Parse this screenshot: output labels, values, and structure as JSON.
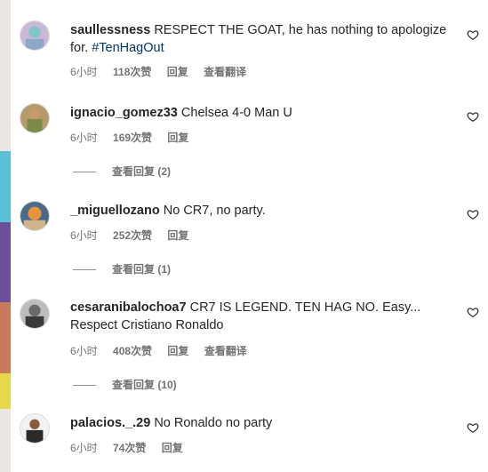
{
  "comments": [
    {
      "username": "saullessness",
      "text": "RESPECT THE GOAT, he has nothing to apologize for.",
      "hashtag": "#TenHagOut",
      "time": "6小时",
      "likes": "118次赞",
      "reply_label": "回复",
      "translate_label": "查看翻译",
      "avatar_colors": [
        "#c9b8d6",
        "#7fc7c9"
      ]
    },
    {
      "username": "ignacio_gomez33",
      "text": "Chelsea 4-0 Man U",
      "time": "6小时",
      "likes": "169次赞",
      "reply_label": "回复",
      "view_replies": "查看回复 (2)",
      "avatar_colors": [
        "#c99a6a",
        "#7a8a4a"
      ]
    },
    {
      "username": "_miguellozano",
      "text": "No CR7, no party.",
      "time": "6小时",
      "likes": "252次赞",
      "reply_label": "回复",
      "view_replies": "查看回复 (1)",
      "avatar_colors": [
        "#e8923a",
        "#4a6a8a"
      ]
    },
    {
      "username": "cesaranibalochoa7",
      "text": "CR7 IS LEGEND. TEN HAG NO. Easy... Respect Cristiano Ronaldo",
      "time": "6小时",
      "likes": "408次赞",
      "reply_label": "回复",
      "translate_label": "查看翻译",
      "view_replies": "查看回复 (10)",
      "avatar_colors": [
        "#9a9a9a",
        "#3a3a3a"
      ]
    },
    {
      "username": "palacios._.29",
      "text": "No Ronaldo no party",
      "time": "6小时",
      "likes": "74次赞",
      "reply_label": "回复",
      "avatar_colors": [
        "#e0e0e0",
        "#2a2a2a"
      ]
    }
  ],
  "colors": {
    "text": "#262626",
    "secondary": "#737373",
    "hashtag": "#00376b",
    "strip": [
      "#e6d7cf",
      "#5bbfd6",
      "#6c4f9a",
      "#c87a5a",
      "#e5d84a"
    ]
  },
  "icons": {
    "like": "heart-outline-icon"
  }
}
